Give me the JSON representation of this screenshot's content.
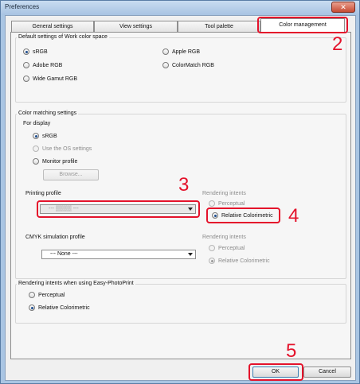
{
  "window": {
    "title": "Preferences",
    "close_glyph": "✕"
  },
  "tabs": [
    {
      "label": "General settings"
    },
    {
      "label": "View settings"
    },
    {
      "label": "Tool palette"
    },
    {
      "label": "Color management"
    }
  ],
  "callouts": {
    "c2": "2",
    "c3": "3",
    "c4": "4",
    "c5": "5"
  },
  "workspace": {
    "title": "Default settings of Work color space",
    "options": [
      "sRGB",
      "Apple RGB",
      "Adobe RGB",
      "ColorMatch RGB",
      "Wide Gamut RGB"
    ],
    "selected": "sRGB"
  },
  "matching": {
    "title": "Color matching settings",
    "display_label": "For display",
    "display_options": [
      "sRGB",
      "Use the OS settings",
      "Monitor profile"
    ],
    "display_selected": "sRGB",
    "browse_label": "Browse...",
    "printing_label": "Printing profile",
    "printing_value": "--- ▒▒▒▒ ---",
    "rendering_label": "Rendering intents",
    "printing_intents": [
      "Perceptual",
      "Relative Colorimetric"
    ],
    "printing_intent_selected": "Relative Colorimetric",
    "cmyk_label": "CMYK simulation profile",
    "cmyk_value": "--- None ---",
    "cmyk_rendering_label": "Rendering intents",
    "cmyk_intents": [
      "Perceptual",
      "Relative Colorimetric"
    ],
    "cmyk_intent_selected": "Relative Colorimetric"
  },
  "easy_photoprint": {
    "title": "Rendering intents when using Easy-PhotoPrint",
    "options": [
      "Perceptual",
      "Relative Colorimetric"
    ],
    "selected": "Relative Colorimetric"
  },
  "buttons": {
    "ok": "OK",
    "cancel": "Cancel"
  },
  "colors": {
    "annotation_red": "#e4122b",
    "frame_blue": "#a9c5e3"
  }
}
